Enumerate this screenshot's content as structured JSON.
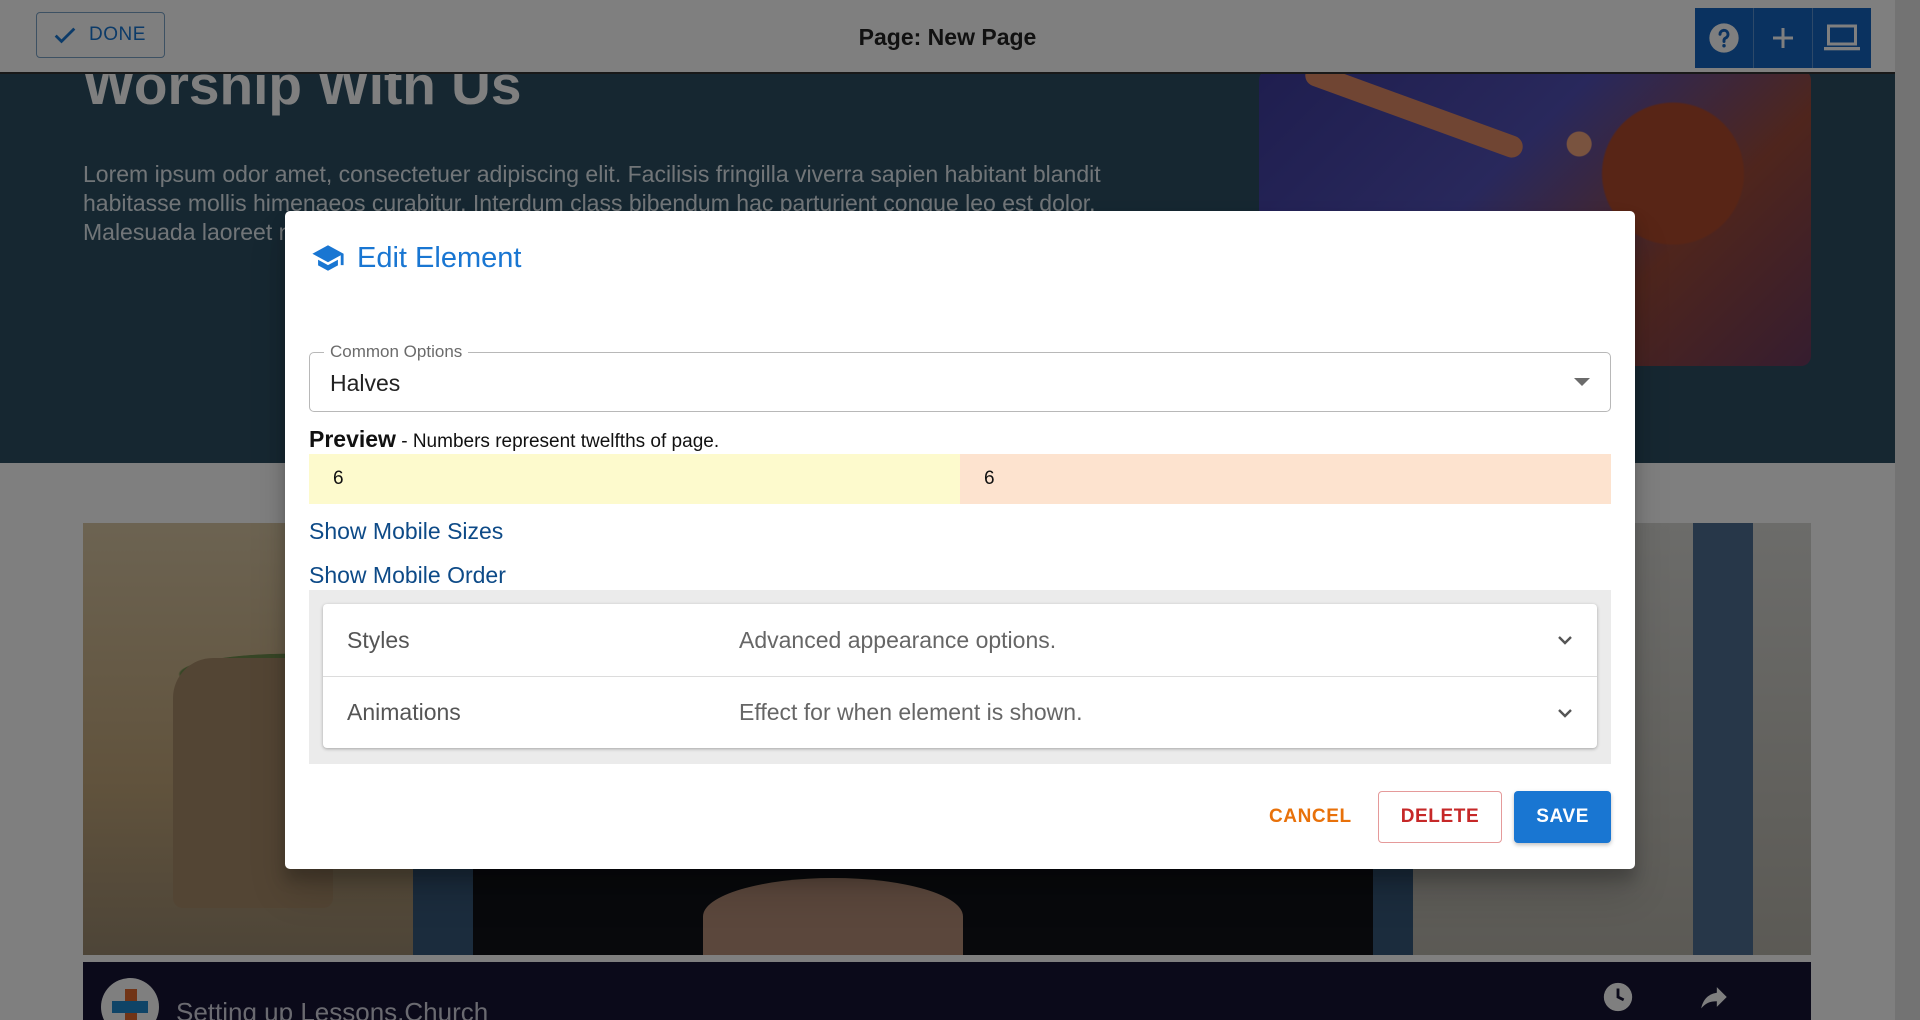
{
  "topbar": {
    "done_label": "DONE",
    "page_title": "Page: New Page",
    "tools": [
      "help-icon",
      "add-icon",
      "laptop-icon"
    ]
  },
  "hero": {
    "title": "Worship With Us",
    "text": "Lorem ipsum odor amet, consectetuer adipiscing elit. Facilisis fringilla viverra sapien habitant blandit habitasse mollis himenaeos curabitur. Interdum class bibendum hac parturient congue leo est dolor. Malesuada laoreet nisi vel phasellus tempor ullamcorper eget. Duis dui fermentum."
  },
  "video": {
    "title": "Setting up Lessons.Church"
  },
  "dialog": {
    "title": "Edit Element",
    "common_options_label": "Common Options",
    "common_options_value": "Halves",
    "preview_label": "Preview",
    "preview_hint": " - Numbers represent twelfths of page.",
    "columns": [
      "6",
      "6"
    ],
    "show_mobile_sizes": "Show Mobile Sizes",
    "show_mobile_order": "Show Mobile Order",
    "accordion": [
      {
        "title": "Styles",
        "description": "Advanced appearance options."
      },
      {
        "title": "Animations",
        "description": "Effect for when element is shown."
      }
    ],
    "buttons": {
      "cancel": "CANCEL",
      "delete": "DELETE",
      "save": "SAVE"
    }
  },
  "colors": {
    "accent": "#1976d2",
    "hero_bg": "#2c4f63",
    "cancel": "#e8710a",
    "delete": "#c62828",
    "col_a": "#fdfacd",
    "col_b": "#fde3cf"
  }
}
